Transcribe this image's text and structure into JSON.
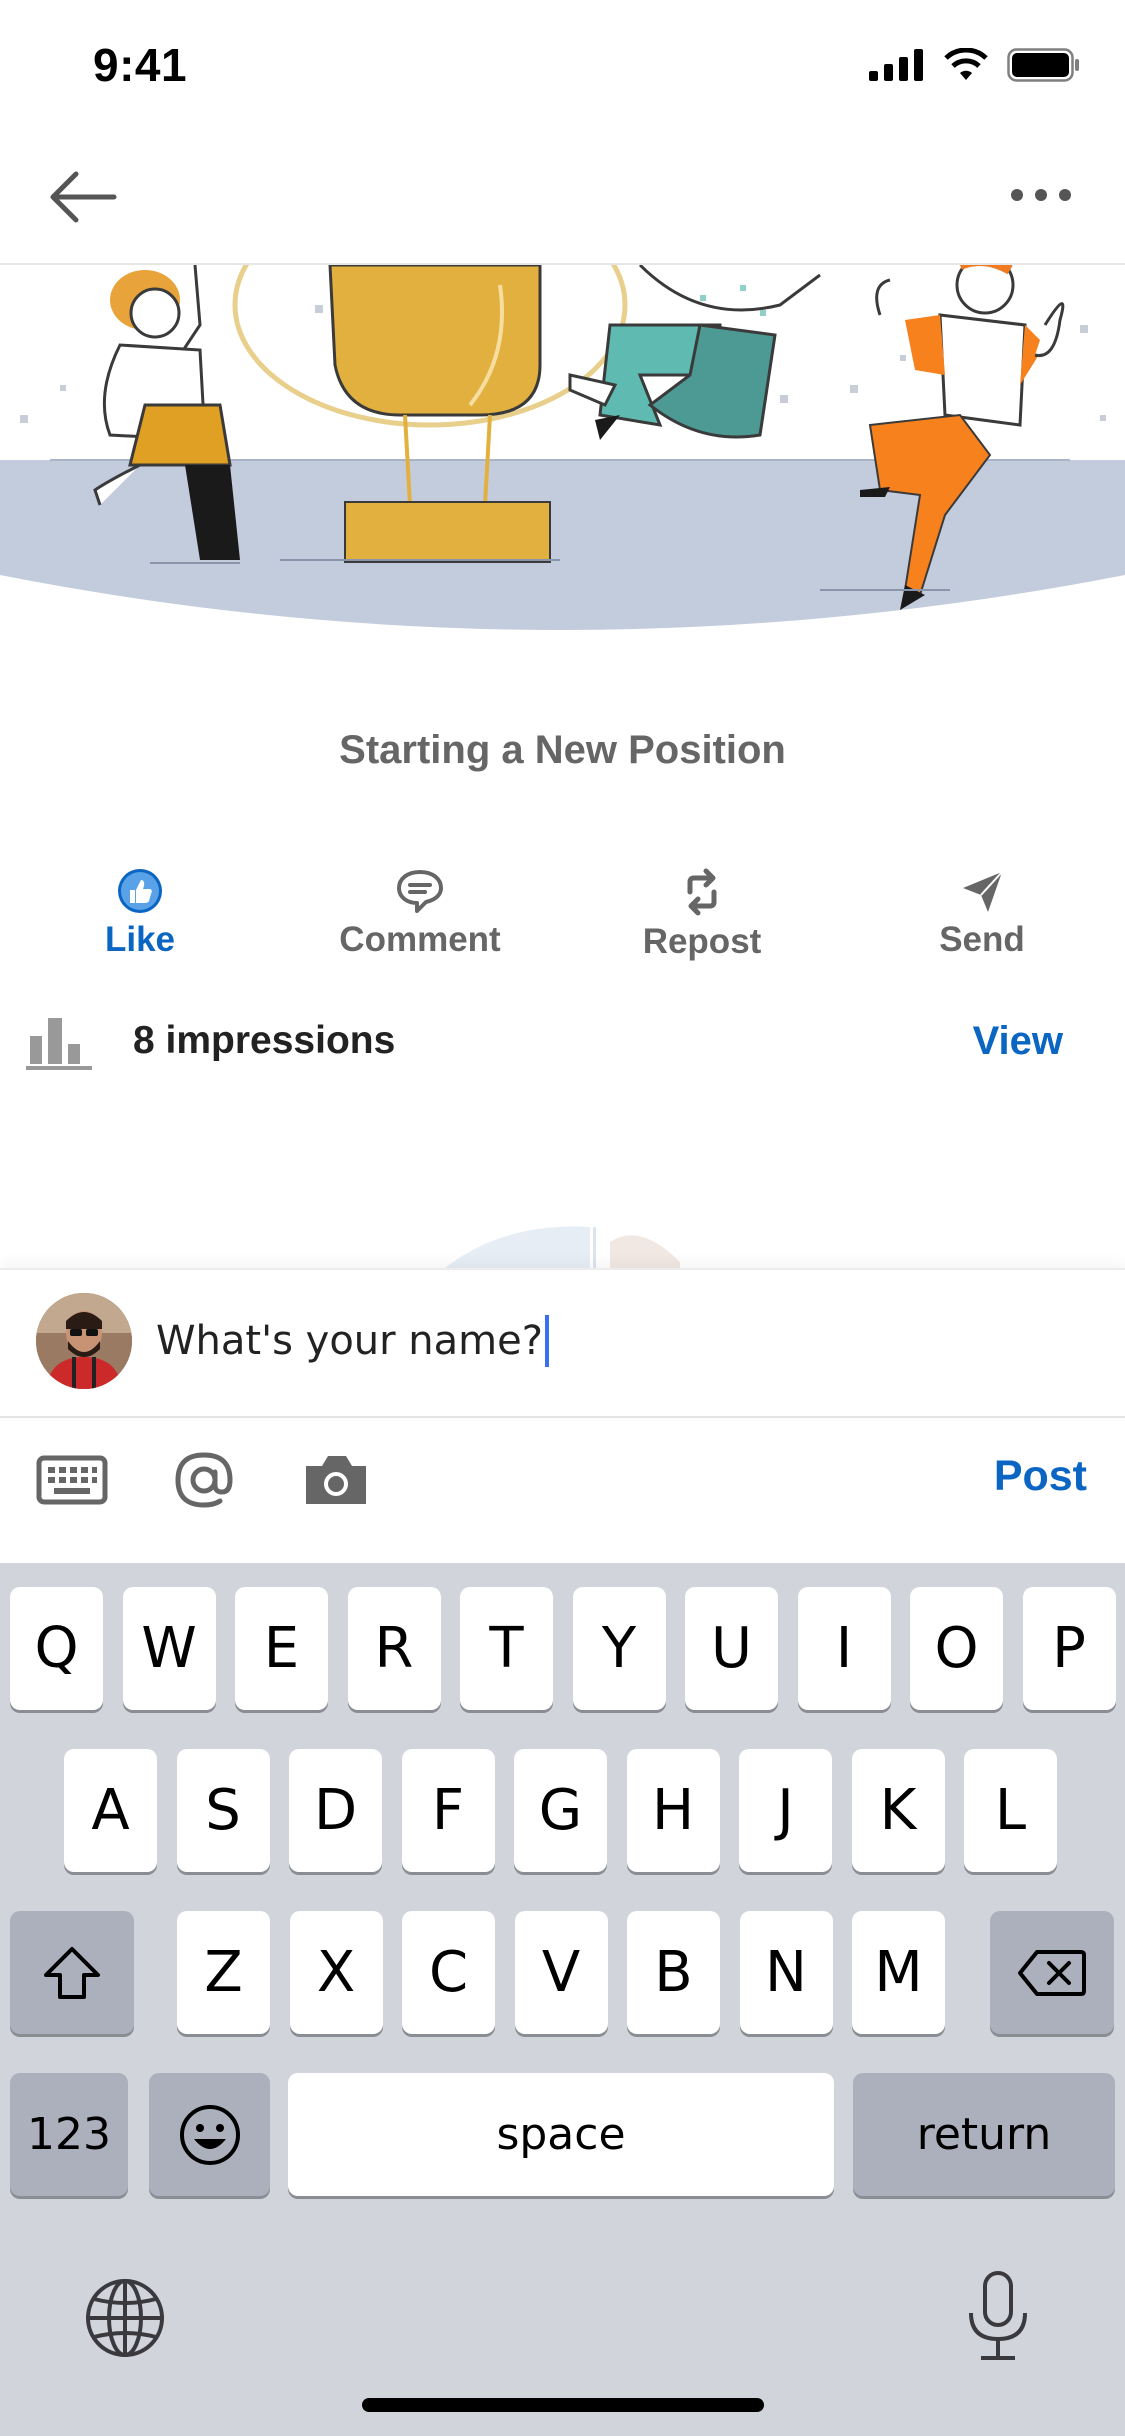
{
  "status_bar": {
    "time": "9:41"
  },
  "nav": {
    "back_icon": "arrow-left-icon",
    "more_icon": "more-horizontal-icon"
  },
  "post": {
    "caption": "Starting a New Position",
    "actions": [
      {
        "label": "Like",
        "icon": "thumbs-up-icon",
        "active": true
      },
      {
        "label": "Comment",
        "icon": "comment-icon",
        "active": false
      },
      {
        "label": "Repost",
        "icon": "repost-icon",
        "active": false
      },
      {
        "label": "Send",
        "icon": "send-icon",
        "active": false
      }
    ],
    "impressions_text": "8 impressions",
    "view_label": "View"
  },
  "composer": {
    "input_value": "What's your name?",
    "post_label": "Post",
    "tools": [
      "keyboard-icon",
      "at-sign-icon",
      "camera-icon"
    ]
  },
  "keyboard": {
    "row1": [
      "Q",
      "W",
      "E",
      "R",
      "T",
      "Y",
      "U",
      "I",
      "O",
      "P"
    ],
    "row2": [
      "A",
      "S",
      "D",
      "F",
      "G",
      "H",
      "J",
      "K",
      "L"
    ],
    "row3": [
      "Z",
      "X",
      "C",
      "V",
      "B",
      "N",
      "M"
    ],
    "numbers_label": "123",
    "space_label": "space",
    "return_label": "return"
  },
  "colors": {
    "accent": "#0a66c2",
    "keyboard_bg": "#d1d4db",
    "dark_key": "#abb0bc"
  }
}
